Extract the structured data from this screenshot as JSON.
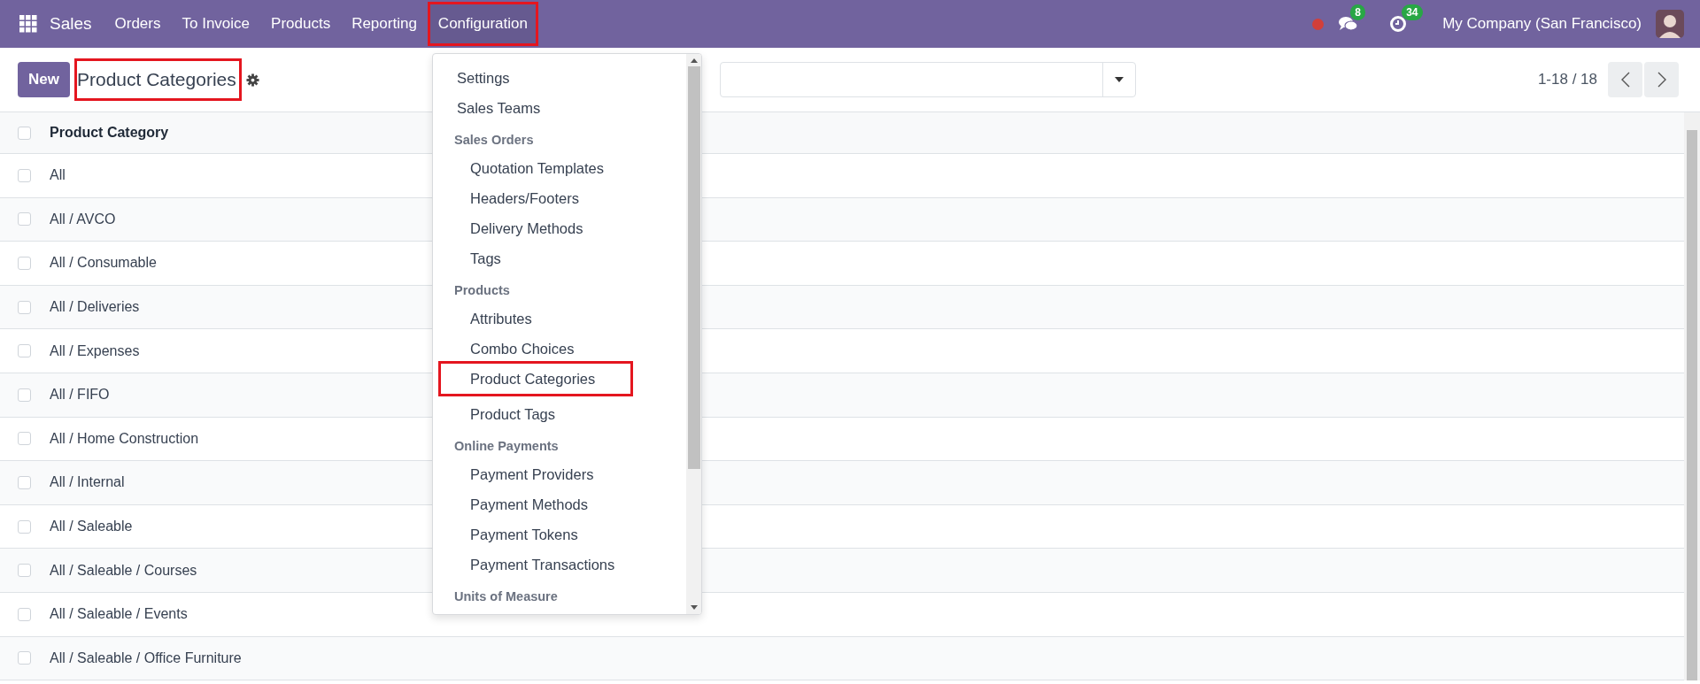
{
  "navbar": {
    "app": "Sales",
    "menu": [
      {
        "label": "Orders",
        "highlighted": false
      },
      {
        "label": "To Invoice",
        "highlighted": false
      },
      {
        "label": "Products",
        "highlighted": false
      },
      {
        "label": "Reporting",
        "highlighted": false
      },
      {
        "label": "Configuration",
        "highlighted": true
      }
    ],
    "messages_count": "8",
    "activities_count": "34",
    "company": "My Company (San Francisco)"
  },
  "control_panel": {
    "new_button": "New",
    "title": "Product Categories",
    "title_highlighted": true,
    "pager": "1-18 / 18"
  },
  "dropdown": {
    "sections": [
      {
        "items": [
          {
            "label": "Settings",
            "highlighted": false
          },
          {
            "label": "Sales Teams",
            "highlighted": false
          }
        ]
      },
      {
        "title": "Sales Orders",
        "items": [
          {
            "label": "Quotation Templates",
            "highlighted": false
          },
          {
            "label": "Headers/Footers",
            "highlighted": false
          },
          {
            "label": "Delivery Methods",
            "highlighted": false
          },
          {
            "label": "Tags",
            "highlighted": false
          }
        ]
      },
      {
        "title": "Products",
        "items": [
          {
            "label": "Attributes",
            "highlighted": false
          },
          {
            "label": "Combo Choices",
            "highlighted": false
          },
          {
            "label": "Product Categories",
            "highlighted": true
          },
          {
            "label": "Product Tags",
            "highlighted": false
          }
        ]
      },
      {
        "title": "Online Payments",
        "items": [
          {
            "label": "Payment Providers",
            "highlighted": false
          },
          {
            "label": "Payment Methods",
            "highlighted": false
          },
          {
            "label": "Payment Tokens",
            "highlighted": false
          },
          {
            "label": "Payment Transactions",
            "highlighted": false
          }
        ]
      },
      {
        "title": "Units of Measure"
      }
    ]
  },
  "table": {
    "all_checked": false,
    "columns": [
      "Product Category"
    ],
    "rows": [
      {
        "name": "All",
        "checked": false
      },
      {
        "name": "All / AVCO",
        "checked": false
      },
      {
        "name": "All / Consumable",
        "checked": false
      },
      {
        "name": "All / Deliveries",
        "checked": false
      },
      {
        "name": "All / Expenses",
        "checked": false
      },
      {
        "name": "All / FIFO",
        "checked": false
      },
      {
        "name": "All / Home Construction",
        "checked": false
      },
      {
        "name": "All / Internal",
        "checked": false
      },
      {
        "name": "All / Saleable",
        "checked": false
      },
      {
        "name": "All / Saleable / Courses",
        "checked": false
      },
      {
        "name": "All / Saleable / Events",
        "checked": false
      },
      {
        "name": "All / Saleable / Office Furniture",
        "checked": false
      }
    ]
  }
}
